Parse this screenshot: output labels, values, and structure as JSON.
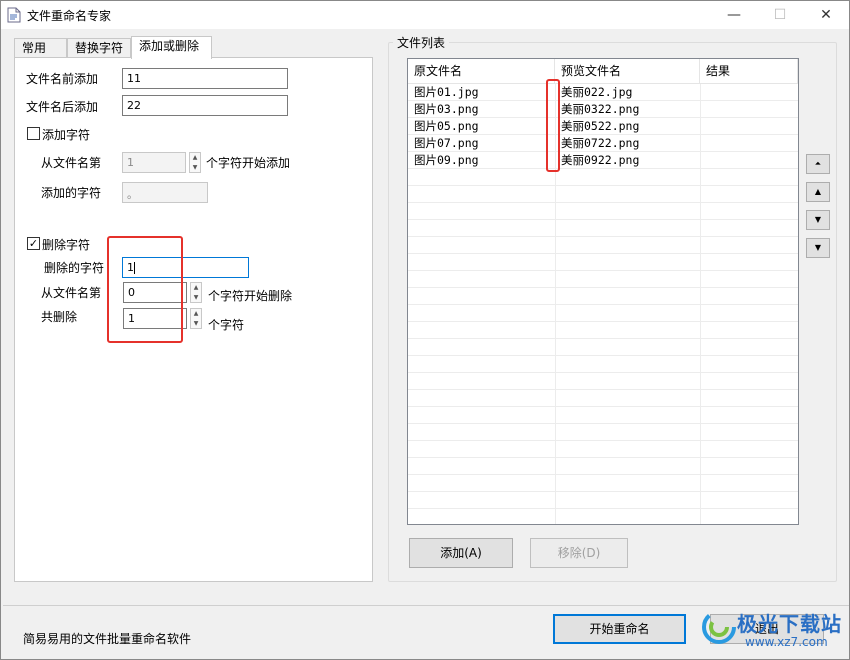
{
  "window": {
    "title": "文件重命名专家",
    "buttons": {
      "minimize": "—",
      "maximize": "☐",
      "close": "✕"
    }
  },
  "tabs": [
    {
      "label": "常用",
      "active": false
    },
    {
      "label": "替换字符",
      "active": false
    },
    {
      "label": "添加或删除",
      "active": true
    }
  ],
  "add_section": {
    "prefix_label": "文件名前添加",
    "prefix_value": "11",
    "suffix_label": "文件名后添加",
    "suffix_value": "22",
    "add_chars_label": "添加字符",
    "add_chars_checked": false,
    "from_pos_label": "从文件名第",
    "from_pos_value": "1",
    "from_pos_suffix": "个字符开始添加",
    "chars_to_add_label": "添加的字符",
    "chars_to_add_value": "。"
  },
  "delete_section": {
    "delete_chars_label": "删除字符",
    "delete_chars_checked": true,
    "check_mark": "✓",
    "chars_to_delete_label": "删除的字符",
    "chars_to_delete_value": "1",
    "from_pos_label": "从文件名第",
    "from_pos_value": "0",
    "from_pos_suffix": "个字符开始删除",
    "total_label": "共删除",
    "total_value": "1",
    "total_suffix": "个字符"
  },
  "file_list": {
    "group_title": "文件列表",
    "columns": [
      "原文件名",
      "预览文件名",
      "结果"
    ],
    "rows": [
      {
        "original": "图片01.jpg",
        "preview": "美丽022.jpg",
        "result": ""
      },
      {
        "original": "图片03.png",
        "preview": "美丽0322.png",
        "result": ""
      },
      {
        "original": "图片05.png",
        "preview": "美丽0522.png",
        "result": ""
      },
      {
        "original": "图片07.png",
        "preview": "美丽0722.png",
        "result": ""
      },
      {
        "original": "图片09.png",
        "preview": "美丽0922.png",
        "result": ""
      }
    ],
    "add_button": "添加(A)",
    "remove_button": "移除(D)",
    "remove_enabled": false,
    "side_buttons": [
      {
        "name": "move-top",
        "glyph": "⏶⏷"
      },
      {
        "name": "move-up",
        "glyph": "▲"
      },
      {
        "name": "move-down",
        "glyph": "▼"
      },
      {
        "name": "move-bottom",
        "glyph": "▼"
      }
    ]
  },
  "footer": {
    "status_text": "简易易用的文件批量重命名软件",
    "start_button": "开始重命名",
    "exit_button": "退出"
  },
  "watermark": {
    "brand": "极光下载站",
    "url": "www.xz7.com"
  },
  "colors": {
    "highlight_red": "#e5312b",
    "focus_blue": "#0078d7",
    "watermark_blue": "#2a6fc4"
  }
}
